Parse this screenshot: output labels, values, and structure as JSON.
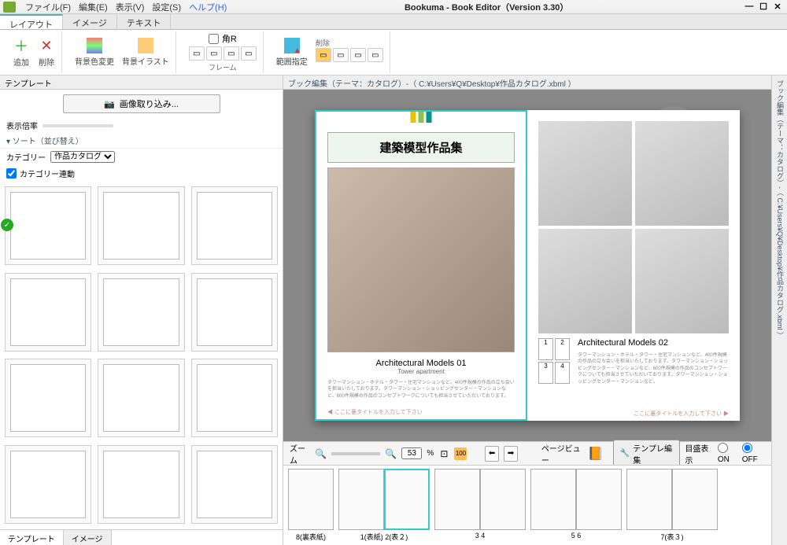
{
  "app": {
    "title": "Bookuma - Book Editor（Version 3.30）"
  },
  "menu": {
    "file": "ファイル(F)",
    "edit": "編集(E)",
    "view": "表示(V)",
    "settings": "設定(S)",
    "help": "ヘルプ(H)"
  },
  "tabs": {
    "layout": "レイアウト",
    "image": "イメージ",
    "text": "テキスト"
  },
  "ribbon": {
    "add": "追加",
    "delete": "削除",
    "bgcolor": "背景色変更",
    "bgillust": "背景イラスト",
    "kadoR": "角R",
    "frame": "フレーム",
    "del2": "削除",
    "range": "範囲指定"
  },
  "sidebar": {
    "header": "テンプレート",
    "import_label": "画像取り込み...",
    "zoom_label": "表示倍率",
    "sort_label": "▾ ソート（並び替え）",
    "category_label": "カテゴリー",
    "category_value": "作品カタログ",
    "category_link": "カテゴリー連動",
    "bottom_tabs": {
      "template": "テンプレート",
      "image": "イメージ"
    }
  },
  "editor": {
    "path": "ブック編集（テーマ：カタログ）-（ C:¥Users¥Q¥Desktop¥作品カタログ.xbml ）",
    "vtab": "ブック編集（テーマ：カタログ）-（ C:¥Users¥Q¥Desktop¥作品カタログ.xbml ）",
    "left": {
      "title": "建築模型作品集",
      "subtitle": "Architectural Models 01",
      "subtitle2": "Tower apartment",
      "footer": "◀ ここに裏タイトルを入力して下さい"
    },
    "right": {
      "subtitle": "Architectural Models 02",
      "cells": [
        "1",
        "2",
        "3",
        "4"
      ],
      "footer": "ここに裏タイトルを入力して下さい ▶"
    }
  },
  "zoombar": {
    "zoom_label": "ズーム",
    "value": "53",
    "percent": "%",
    "pagebiew": "ページビュー",
    "edit_template": "テンプレ編集",
    "guide_label": "目盛表示",
    "on": "ON",
    "off": "OFF"
  },
  "thumbs": [
    {
      "label": "8(裏表紙)",
      "pages": 1
    },
    {
      "label": "1(表紙) 2(表２)",
      "pages": 2,
      "selected": true
    },
    {
      "label": "3    4",
      "pages": 2
    },
    {
      "label": "5    6",
      "pages": 2
    },
    {
      "label": "7(表３)",
      "pages": 2
    }
  ],
  "colors": {
    "accent": [
      "#e6c300",
      "#8bc34a",
      "#009688"
    ]
  }
}
